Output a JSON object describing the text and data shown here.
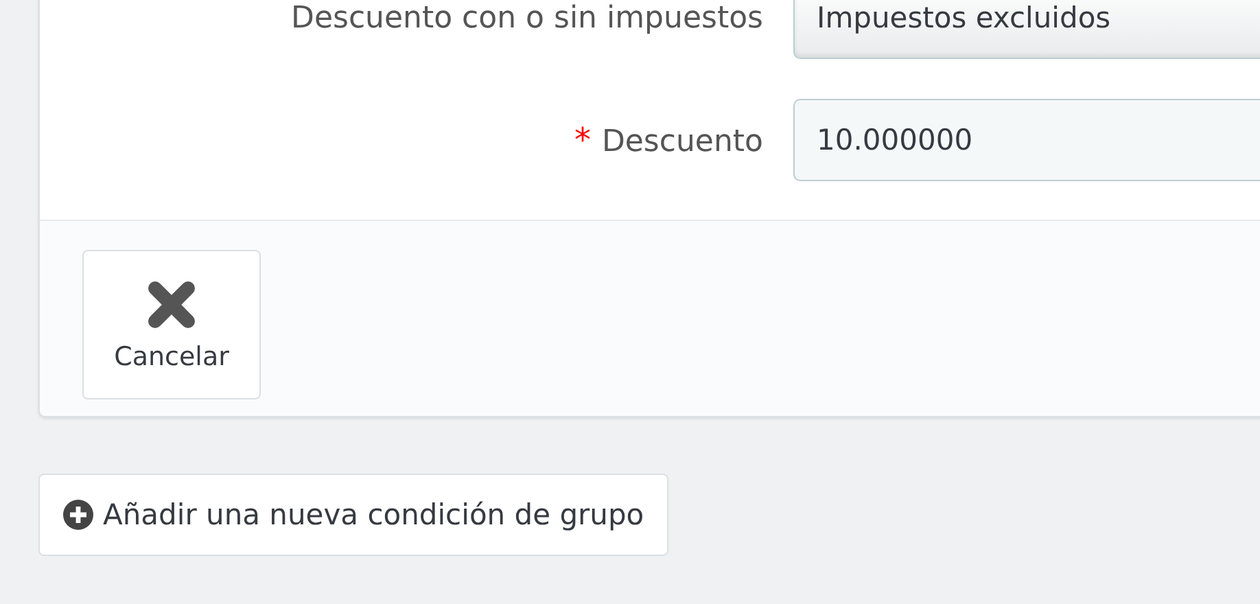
{
  "form": {
    "fields": [
      {
        "kind": "select",
        "label": "Descuento con o sin impuestos",
        "value": "Impuestos excluidos"
      },
      {
        "kind": "input",
        "label": "Descuento",
        "required_mark": "*",
        "value": "10.000000"
      }
    ]
  },
  "footer": {
    "buttons": [
      {
        "label": "Cancelar"
      }
    ]
  },
  "add_button": {
    "label": "Añadir una nueva condición de grupo"
  }
}
